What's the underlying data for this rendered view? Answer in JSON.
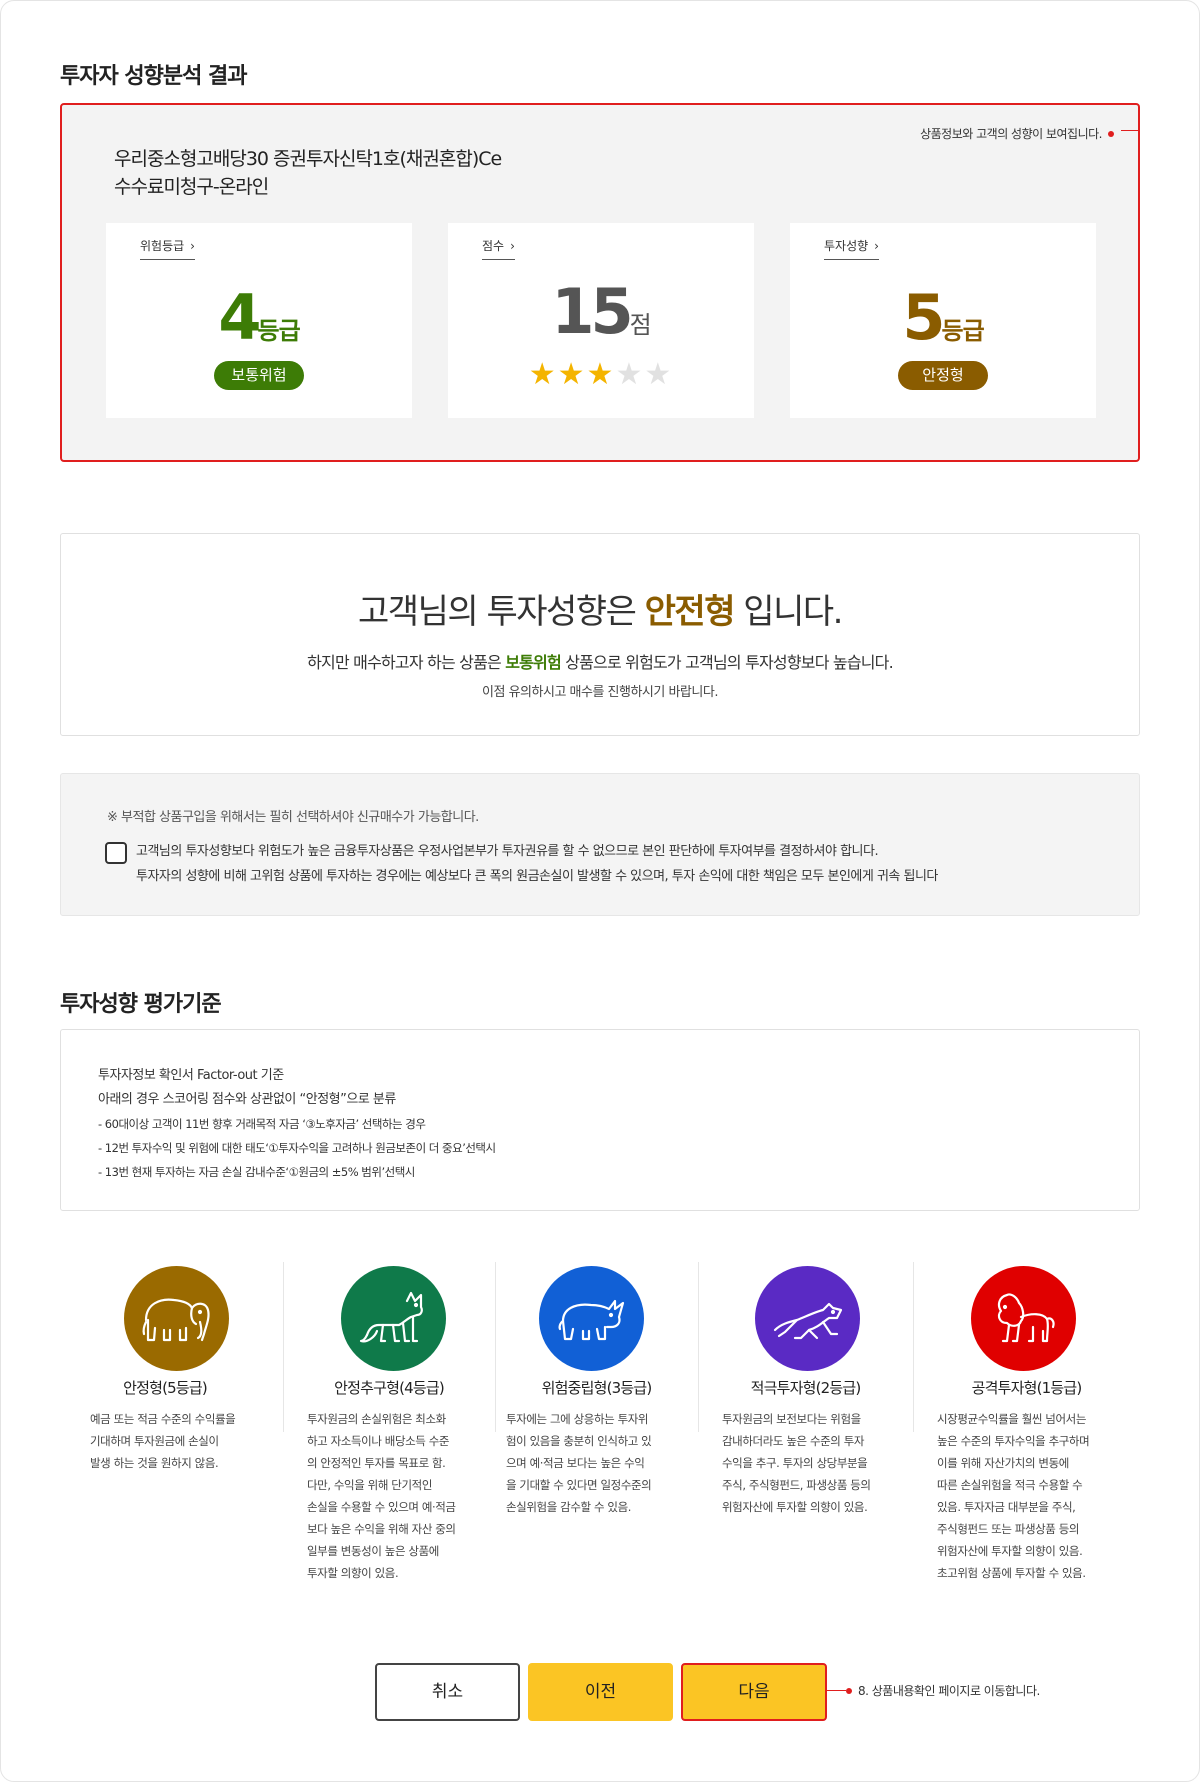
{
  "result_section": {
    "title": "투자자 성향분석 결과",
    "annotation": "상품정보와 고객의 성향이 보여집니다.",
    "product_name_line1": "우리중소형고배당30 증권투자신탁1호(채권혼합)Ce",
    "product_name_line2": "수수료미청구-온라인",
    "risk_card": {
      "tab": "위험등급",
      "value": "4",
      "unit": "등급",
      "badge": "보통위험",
      "color": "#3d7c06"
    },
    "score_card": {
      "tab": "점수",
      "value": "15",
      "unit": "점",
      "stars_filled": 3,
      "stars_total": 5
    },
    "propensity_card": {
      "tab": "투자성향",
      "value": "5",
      "unit": "등급",
      "badge": "안정형",
      "color": "#8a5c00"
    }
  },
  "notice": {
    "main_prefix": "고객님의 투자성향은 ",
    "main_highlight": "안전형",
    "main_suffix": " 입니다.",
    "sub_prefix": "하지만 매수하고자 하는 상품은 ",
    "sub_highlight": "보통위험",
    "sub_suffix": " 상품으로 위험도가 고객님의 투자성향보다 높습니다.",
    "sub2": "이점 유의하시고 매수를 진행하시기 바랍니다."
  },
  "warning": {
    "note": "※ 부적합 상품구입을 위해서는 필히 선택하셔야 신규매수가 가능합니다.",
    "check_line1": "고객님의 투자성향보다 위험도가 높은 금융투자상품은 우정사업본부가 투자권유를 할 수 없으므로 본인 판단하에 투자여부를 결정하셔야 합니다.",
    "check_line2": "투자자의 성향에 비해 고위험 상품에 투자하는 경우에는 예상보다 큰 폭의 원금손실이 발생할 수 있으며, 투자 손익에 대한 책임은 모두 본인에게 귀속 됩니다"
  },
  "criteria_section": {
    "title": "투자성향 평가기준",
    "line1": "투자자정보 확인서 Factor-out 기준",
    "line2": "아래의 경우 스코어링 점수와 상관없이 “안정형”으로 분류",
    "bullets": [
      "- 60대이상 고객이 11번 향후 거래목적 자금 ‘③노후자금’ 선택하는 경우",
      "- 12번 투자수익 및 위험에 대한 태도‘①투자수익을 고려하나 원금보존이 더 중요’선택시",
      "- 13번 현재 투자하는 자금 손실 감내수준‘①원금의 ±5% 범위’선택시"
    ]
  },
  "types": [
    {
      "name": "안정형(5등급)",
      "icon": "elephant-icon",
      "color": "#9a6a00",
      "desc": [
        "예금 또는 적금 수준의 수익률을",
        "기대하며 투자원금에 손실이",
        "발생 하는 것을 원하지 않음."
      ]
    },
    {
      "name": "안정추구형(4등급)",
      "icon": "fox-icon",
      "color": "#0f7a4a",
      "desc": [
        "투자원금의 손실위험은 최소화",
        "하고 자소득이나 배당소득 수준",
        "의  안정적인 투자를 목표로 함.",
        "다만, 수익을 위해 단기적인",
        "손실을 수용할 수 있으며 예·적금",
        "보다 높은 수익을 위해 자산 중의",
        "일부를 변동성이 높은 상품에",
        "투자할 의향이 있음."
      ]
    },
    {
      "name": "위험중립형(3등급)",
      "icon": "rhino-icon",
      "color": "#1160d6",
      "desc": [
        "투자에는 그에 상응하는 투자위",
        "험이 있음을 충분히 인식하고 있",
        "으며 예·적금 보다는 높은 수익",
        "을 기대할 수 있다면 일정수준의",
        "손실위험을 감수할 수 있음."
      ]
    },
    {
      "name": "적극투자형(2등급)",
      "icon": "cheetah-icon",
      "color": "#5a2ac4",
      "desc": [
        "투자원금의 보전보다는 위험을",
        "감내하더라도 높은 수준의 투자",
        "수익을 추구. 투자의 상당부분을",
        "주식, 주식형펀드, 파생상품 등의",
        "위험자산에 투자할 의향이 있음."
      ]
    },
    {
      "name": "공격투자형(1등급)",
      "icon": "lion-icon",
      "color": "#e00000",
      "desc": [
        "시장평균수익률을 훨씬 넘어서는",
        "높은 수준의 투자수익을 추구하며",
        "이를 위해 자산가치의 변동에",
        "따른 손실위험을 적극 수용할 수",
        "있음. 투자자금 대부분을 주식,",
        "주식형펀드 또는 파생상품 등의",
        "위험자산에 투자할 의향이 있음.",
        "초고위험 상품에 투자할 수 있음."
      ]
    }
  ],
  "buttons": {
    "cancel": "취소",
    "prev": "이전",
    "next": "다음"
  },
  "bottom_annotation": "8. 상품내용확인 페이지로 이동합니다.",
  "colors": {
    "accent_red": "#e01e1e",
    "button_yellow": "#fbc524",
    "safe_brown": "#8a5c00",
    "normal_green": "#3d7c06"
  }
}
